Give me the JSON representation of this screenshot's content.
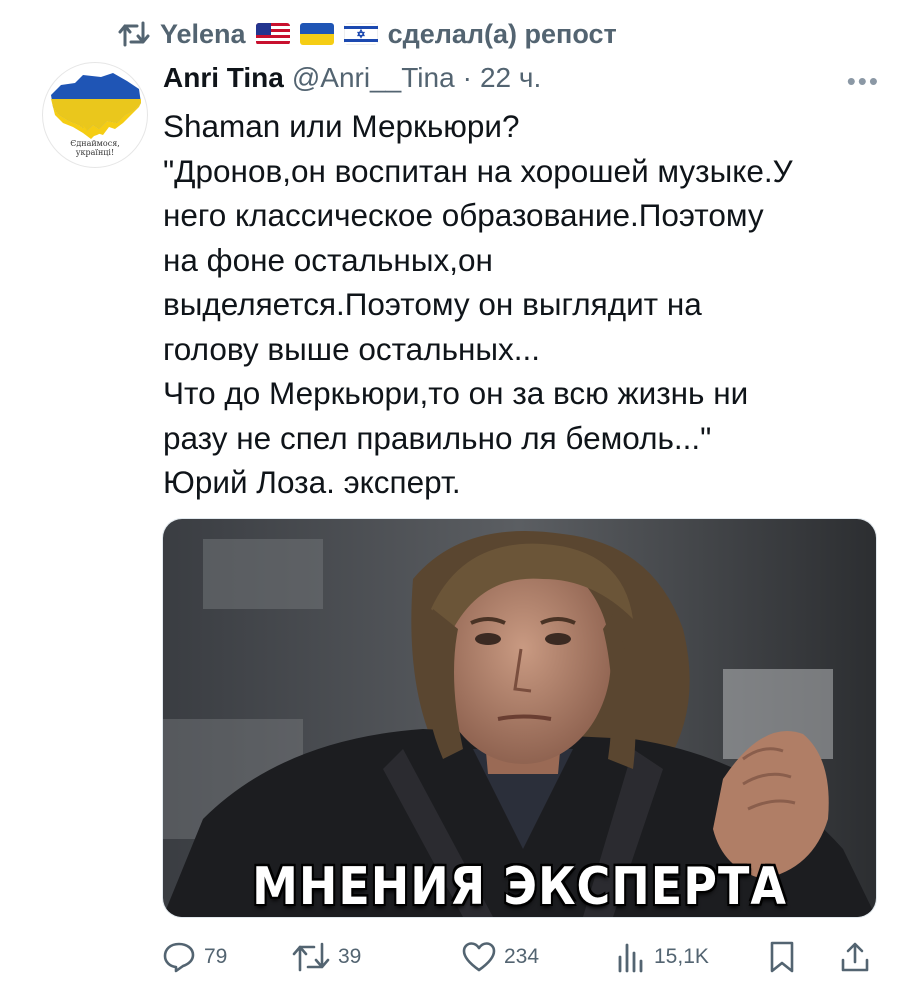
{
  "repost": {
    "user": "Yelena",
    "flags": [
      "us-flag",
      "ukraine-flag",
      "israel-flag"
    ],
    "action": "сделал(а) репост"
  },
  "author": {
    "name": "Anri Tina",
    "handle": "@Anri__Tina",
    "separator": "·",
    "time": "22 ч.",
    "avatar_caption_line1": "Єднаймося,",
    "avatar_caption_line2": "українці!"
  },
  "tweet": {
    "lines": [
      "Shaman или Меркьюри?",
      "\"Дронов,он воспитан на хорошей музыке.У",
      "него классическое образование.Поэтому",
      "на фоне остальных,он",
      "выделяется.Поэтому он выглядит на",
      "голову выше остальных...",
      "Что до Меркьюри,то он за всю жизнь ни",
      "разу не спел правильно ля бемоль...\"",
      "Юрий Лоза. эксперт."
    ]
  },
  "media": {
    "caption": "МНЕНИЯ ЭКСПЕРТА"
  },
  "stats": {
    "replies": "79",
    "reposts": "39",
    "likes": "234",
    "views": "15,1K"
  },
  "colors": {
    "text": "#0f1419",
    "secondary": "#536471",
    "ukraine_blue": "#1f55b5",
    "ukraine_yellow": "#f5cd14"
  }
}
